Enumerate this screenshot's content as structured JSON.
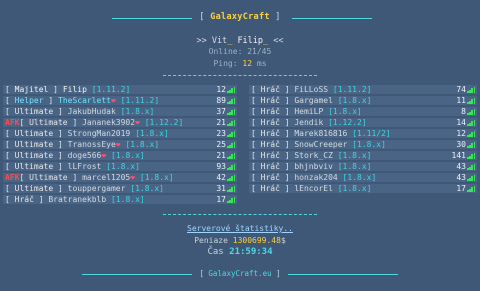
{
  "header": {
    "open_bracket": "[",
    "server_name": "GalaxyCraft",
    "close_bracket": "]"
  },
  "welcome": {
    "prefix": ">> Vit",
    "separator": "_",
    "username": "Filip",
    "cursor": "_",
    "suffix": "<<"
  },
  "online": {
    "label": "Online:",
    "value": "21/45"
  },
  "ping": {
    "label": "Ping:",
    "value": "12",
    "unit": "ms"
  },
  "players_left": [
    {
      "tag": "Majitel",
      "tag_type": "owner",
      "afk": false,
      "name": "Filip",
      "name_style": "white",
      "heart": false,
      "version": "1.11.2",
      "ping": "12"
    },
    {
      "tag": "Helper",
      "tag_type": "helper",
      "afk": false,
      "name": "TheScarlett",
      "name_style": "cyan",
      "heart": true,
      "version": "1.11.2",
      "ping": "89"
    },
    {
      "tag": "Ultimate",
      "tag_type": "ult",
      "afk": false,
      "name": "JakubHudak",
      "name_style": "",
      "heart": false,
      "version": "1.8.x",
      "ping": "37"
    },
    {
      "tag": "Ultimate",
      "tag_type": "ult",
      "afk": true,
      "name": "Jananek3902",
      "name_style": "",
      "heart": true,
      "version": "1.12.2",
      "ping": "21"
    },
    {
      "tag": "Ultimate",
      "tag_type": "ult",
      "afk": false,
      "name": "StrongMan2019",
      "name_style": "",
      "heart": false,
      "version": "1.8.x",
      "ping": "23"
    },
    {
      "tag": "Ultimate",
      "tag_type": "ult",
      "afk": false,
      "name": "TranossEye",
      "name_style": "",
      "heart": true,
      "version": "1.8.x",
      "ping": "25"
    },
    {
      "tag": "Ultimate",
      "tag_type": "ult",
      "afk": false,
      "name": "doge566",
      "name_style": "",
      "heart": true,
      "version": "1.8.x",
      "ping": "21"
    },
    {
      "tag": "Ultimate",
      "tag_type": "ult",
      "afk": false,
      "name": "lLFrost",
      "name_style": "",
      "heart": false,
      "version": "1.8.x",
      "ping": "93"
    },
    {
      "tag": "Ultimate",
      "tag_type": "ult",
      "afk": true,
      "name": "marcel1205",
      "name_style": "",
      "heart": true,
      "version": "1.8.x",
      "ping": "42"
    },
    {
      "tag": "Ultimate",
      "tag_type": "ult",
      "afk": false,
      "name": "touppergamer",
      "name_style": "",
      "heart": false,
      "version": "1.8.x",
      "ping": "31"
    },
    {
      "tag": "Hráč",
      "tag_type": "hrac",
      "afk": false,
      "name": "Bratranekblb",
      "name_style": "",
      "heart": false,
      "version": "1.8.x",
      "ping": "17"
    }
  ],
  "players_right": [
    {
      "tag": "Hráč",
      "name": "FiLLoSS",
      "version": "1.11.2",
      "ping": "74"
    },
    {
      "tag": "Hráč",
      "name": "Gargamel",
      "version": "1.8.x",
      "ping": "11"
    },
    {
      "tag": "Hráč",
      "name": "HemiLP",
      "version": "1.8.x",
      "ping": "8"
    },
    {
      "tag": "Hráč",
      "name": "Jendik",
      "version": "1.12.2",
      "ping": "14"
    },
    {
      "tag": "Hráč",
      "name": "Marek816816",
      "version": "1.11/2",
      "ping": "12"
    },
    {
      "tag": "Hráč",
      "name": "SnowCreeper",
      "version": "1.8.x",
      "ping": "30"
    },
    {
      "tag": "Hráč",
      "name": "Stork_CZ",
      "version": "1.8.x",
      "ping": "141"
    },
    {
      "tag": "Hráč",
      "name": "bhjnbviv",
      "version": "1.8.x",
      "ping": "43"
    },
    {
      "tag": "Hráč",
      "name": "honzak204",
      "version": "1.8.x",
      "ping": "43"
    },
    {
      "tag": "Hráč",
      "name": "lEncorEl",
      "version": "1.8.x",
      "ping": "17"
    }
  ],
  "footer": {
    "stats_link": "Serverové štatistiky..",
    "money_label": "Peniaze",
    "money_value": "1300699.48",
    "money_symbol": "$",
    "time_label": "Čas",
    "time_value": "21:59:34",
    "bottom_open": "[",
    "bottom_name": "GalaxyCraft.eu",
    "bottom_close": "]"
  },
  "colors": {
    "background": "#3f5877",
    "accent_cyan": "#4fd8e0",
    "gold": "#ffd23a",
    "afk_red": "#ff4b4b",
    "ping_green": "#39e35a"
  }
}
